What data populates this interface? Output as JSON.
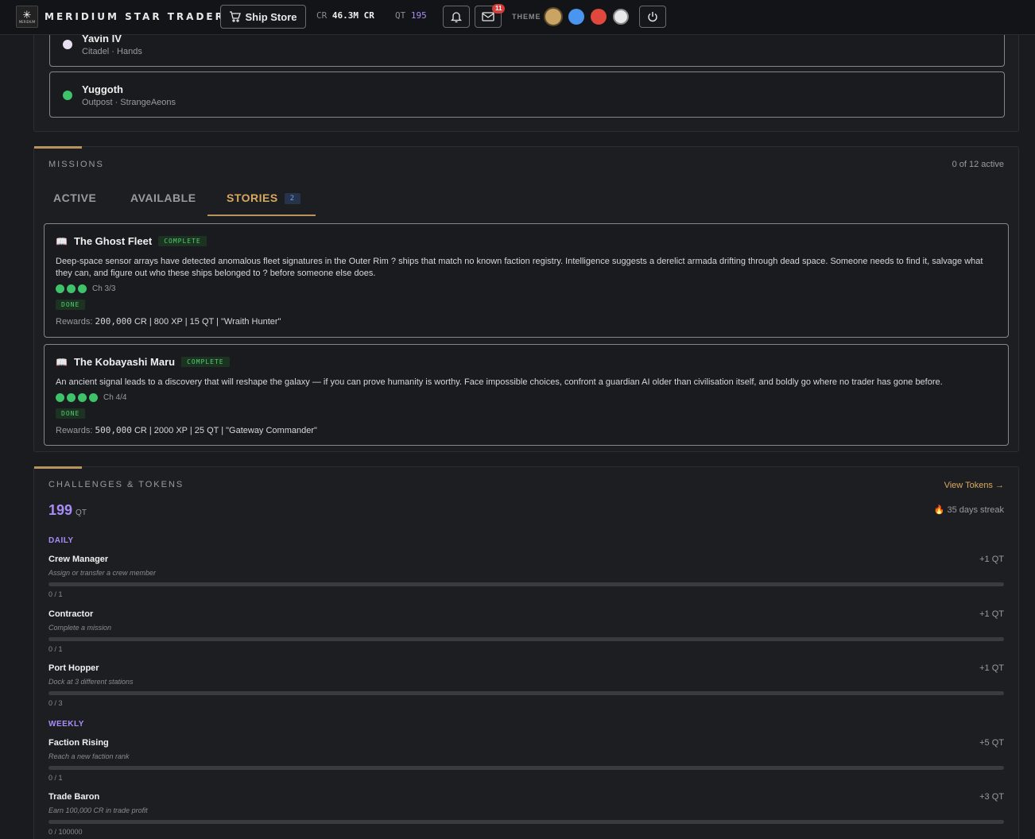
{
  "brand": {
    "name": "MERIDIUM STAR TRADERS",
    "logo_text": "MERIDIUM"
  },
  "topbar": {
    "ship_store": "Ship Store",
    "cr_label": "CR",
    "cr_value": "46.3M CR",
    "qt_label": "QT",
    "qt_value": "195",
    "mail_count": "11",
    "theme_label": "THEME",
    "themes": [
      "#c9a464",
      "#4a95f0",
      "#e0473d",
      "#e8e8ea"
    ]
  },
  "locations": [
    {
      "name": "Yavin IV",
      "sub": "Citadel · Hands",
      "color": "#e8e0f0"
    },
    {
      "name": "Yuggoth",
      "sub": "Outpost · StrangeAeons",
      "color": "#3fc36a"
    }
  ],
  "missions": {
    "title": "MISSIONS",
    "active_count": "0 of 12 active",
    "tabs": [
      {
        "label": "ACTIVE"
      },
      {
        "label": "AVAILABLE"
      },
      {
        "label": "STORIES",
        "count": "2"
      }
    ],
    "stories": [
      {
        "title": "The Ghost Fleet",
        "status": "COMPLETE",
        "description": "Deep-space sensor arrays have detected anomalous fleet signatures in the Outer Rim ? ships that match no known faction registry. Intelligence suggests a derelict armada drifting through dead space. Someone needs to find it, salvage what they can, and figure out who these ships belonged to ? before someone else does.",
        "chapters_done": 3,
        "chapter_label": "Ch 3/3",
        "done_label": "DONE",
        "rewards_label": "Rewards:",
        "reward_cr": "200,000",
        "reward_rest": "CR | 800 XP | 15 QT | \"Wraith Hunter\""
      },
      {
        "title": "The Kobayashi Maru",
        "status": "COMPLETE",
        "description": "An ancient signal leads to a discovery that will reshape the galaxy — if you can prove humanity is worthy. Face impossible choices, confront a guardian AI older than civilisation itself, and boldly go where no trader has gone before.",
        "chapters_done": 4,
        "chapter_label": "Ch 4/4",
        "done_label": "DONE",
        "rewards_label": "Rewards:",
        "reward_cr": "500,000",
        "reward_rest": "CR | 2000 XP | 25 QT | \"Gateway Commander\""
      }
    ]
  },
  "challenges": {
    "title": "CHALLENGES & TOKENS",
    "view_tokens": "View Tokens →",
    "qt_amount": "199",
    "qt_unit": "QT",
    "streak": "35 days streak",
    "daily_label": "DAILY",
    "weekly_label": "WEEKLY",
    "daily": [
      {
        "name": "Crew Manager",
        "desc": "Assign or transfer a crew member",
        "reward": "+1 QT",
        "progress": "0 / 1",
        "fraction": 0
      },
      {
        "name": "Contractor",
        "desc": "Complete a mission",
        "reward": "+1 QT",
        "progress": "0 / 1",
        "fraction": 0
      },
      {
        "name": "Port Hopper",
        "desc": "Dock at 3 different stations",
        "reward": "+1 QT",
        "progress": "0 / 3",
        "fraction": 0
      }
    ],
    "weekly": [
      {
        "name": "Faction Rising",
        "desc": "Reach a new faction rank",
        "reward": "+5 QT",
        "progress": "0 / 1",
        "fraction": 0
      },
      {
        "name": "Trade Baron",
        "desc": "Earn 100,000 CR in trade profit",
        "reward": "+3 QT",
        "progress": "0 / 100000",
        "fraction": 0
      }
    ]
  }
}
